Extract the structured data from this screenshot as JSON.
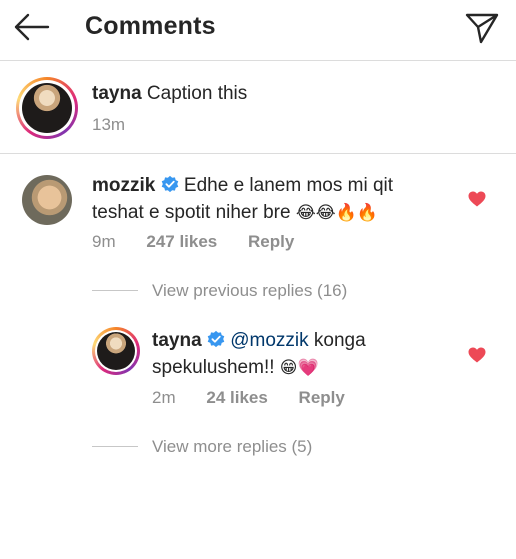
{
  "header": {
    "title": "Comments"
  },
  "caption": {
    "username": "tayna",
    "text": "Caption this",
    "time": "13m"
  },
  "comment": {
    "username": "mozzik",
    "verified": true,
    "line1": "Edhe e lanem mos mi qit",
    "line2": "teshat e spotit niher bre",
    "emojis": "😂😂🔥🔥",
    "time": "9m",
    "likes": "247 likes",
    "reply_label": "Reply",
    "view_previous": "View previous replies (16)"
  },
  "reply": {
    "username": "tayna",
    "verified": true,
    "mention": "@mozzik",
    "line1_rest": " konga",
    "line2": "spekulushem!!",
    "emojis": "😁💗",
    "time": "2m",
    "likes": "24 likes",
    "reply_label": "Reply",
    "view_more": "View more replies (5)"
  },
  "colors": {
    "heart": "#ed4956",
    "verified": "#3897f0",
    "meta": "#8e8e8e",
    "mention": "#00376b"
  }
}
